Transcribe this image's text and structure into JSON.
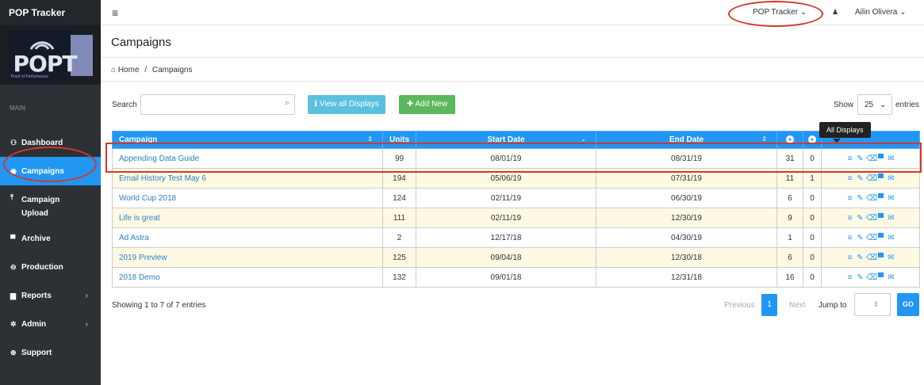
{
  "app": {
    "brand": "POP Tracker"
  },
  "logo": {
    "text": "POPT",
    "subtext": "Proof of Performance"
  },
  "sidebar": {
    "section_label": "MAIN",
    "items": [
      {
        "label": "Dashboard",
        "icon": "dashboard-icon"
      },
      {
        "label": "Campaigns",
        "icon": "campaigns-icon",
        "active": true
      },
      {
        "label": "Campaign Upload",
        "icon": "upload-icon"
      },
      {
        "label": "Archive",
        "icon": "archive-icon"
      },
      {
        "label": "Production",
        "icon": "print-icon"
      },
      {
        "label": "Reports",
        "icon": "reports-icon",
        "has_arrow": true
      },
      {
        "label": "Admin",
        "icon": "gear-icon",
        "has_arrow": true
      },
      {
        "label": "Support",
        "icon": "support-icon"
      }
    ]
  },
  "topbar": {
    "tracker_label": "POP Tracker",
    "user_name": "Ailin Olivera"
  },
  "page": {
    "title": "Campaigns",
    "breadcrumb_home": "Home",
    "breadcrumb_sep": "/",
    "breadcrumb_current": "Campaigns"
  },
  "controls": {
    "search_label": "Search",
    "search_value": "",
    "view_all_label": "View all Displays",
    "add_new_label": "Add New",
    "show_label": "Show",
    "show_value": "25",
    "entries_label": "entries"
  },
  "table": {
    "columns": [
      "Campaign",
      "Units",
      "Start Date",
      "End Date",
      "",
      "",
      ""
    ],
    "rows": [
      {
        "campaign": "Appending Data Guide",
        "units": "99",
        "start": "08/01/19",
        "end": "08/31/19",
        "a": "31",
        "b": "0"
      },
      {
        "campaign": "Email History Test May 6",
        "units": "194",
        "start": "05/06/19",
        "end": "07/31/19",
        "a": "11",
        "b": "1"
      },
      {
        "campaign": "World Cup 2018",
        "units": "124",
        "start": "02/11/19",
        "end": "06/30/19",
        "a": "6",
        "b": "0"
      },
      {
        "campaign": "Life is great",
        "units": "111",
        "start": "02/11/19",
        "end": "12/30/19",
        "a": "9",
        "b": "0"
      },
      {
        "campaign": "Ad Astra",
        "units": "2",
        "start": "12/17/18",
        "end": "04/30/19",
        "a": "1",
        "b": "0"
      },
      {
        "campaign": "2019 Preview",
        "units": "125",
        "start": "09/04/18",
        "end": "12/30/18",
        "a": "6",
        "b": "0"
      },
      {
        "campaign": "2018 Demo",
        "units": "132",
        "start": "09/01/18",
        "end": "12/31/18",
        "a": "16",
        "b": "0"
      }
    ]
  },
  "tooltip": {
    "text": "All Displays"
  },
  "footer": {
    "showing": "Showing 1 to 7 of 7 entries",
    "previous": "Previous",
    "current_page": "1",
    "next": "Next",
    "jump_label": "Jump to",
    "go_label": "GO"
  },
  "colors": {
    "primary": "#2196f3",
    "sidebar": "#2c3136",
    "success": "#5cb85c",
    "info": "#5bc0de",
    "annotation": "#d5372a"
  }
}
